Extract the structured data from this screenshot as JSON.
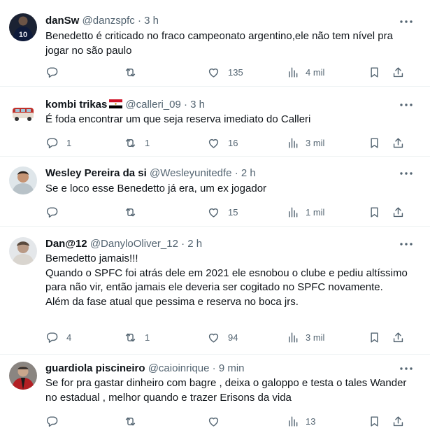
{
  "tweets": [
    {
      "name": "danSw",
      "handle": "@danzspfc",
      "dot": "·",
      "time": "3 h",
      "text": "Benedetto é criticado no fraco campeonato argentino,ele não tem nível pra jogar no são paulo",
      "replies": "",
      "retweets": "",
      "likes": "135",
      "views": "4 mil"
    },
    {
      "name": "kombi trikas",
      "handle": "@calleri_09",
      "dot": "·",
      "time": "3 h",
      "text": "É foda encontrar um que seja reserva imediato do Calleri",
      "replies": "1",
      "retweets": "1",
      "likes": "16",
      "views": "3 mil",
      "flag_colors": [
        "#ce1126",
        "#ffffff",
        "#000000"
      ]
    },
    {
      "name": "Wesley Pereira da si",
      "handle": "@Wesleyunitedfe",
      "dot": "·",
      "time": "2 h",
      "text": "Se e loco esse Benedetto já era, um ex jogador",
      "replies": "",
      "retweets": "",
      "likes": "15",
      "views": "1 mil"
    },
    {
      "name": "Dan@12",
      "handle": "@DanyloOliver_12",
      "dot": "·",
      "time": "2 h",
      "text": "Bemedetto jamais!!!\nQuando o SPFC foi atrás dele em 2021 ele esnobou o clube e pediu altíssimo para não vir, então jamais ele deveria ser cogitado no SPFC novamente.\nAlém da fase atual que pessima e reserva no boca jrs.",
      "replies": "4",
      "retweets": "1",
      "likes": "94",
      "views": "3 mil"
    },
    {
      "name": "guardiola piscineiro",
      "handle": "@caioinrique",
      "dot": "·",
      "time": "9 min",
      "text": "Se for pra gastar dinheiro com bagre , deixa o galoppo e testa o tales Wander no estadual , melhor quando e trazer Erisons da vida",
      "replies": "",
      "retweets": "",
      "likes": "",
      "views": "13"
    }
  ],
  "icons": {
    "more": "more-horizontal-icon",
    "reply": "reply-icon",
    "retweet": "retweet-icon",
    "like": "heart-icon",
    "views": "views-bar-chart-icon",
    "bookmark": "bookmark-icon",
    "share": "share-icon"
  },
  "colors": {
    "text": "#0f1419",
    "secondary": "#536471",
    "divider": "#eff3f4"
  }
}
